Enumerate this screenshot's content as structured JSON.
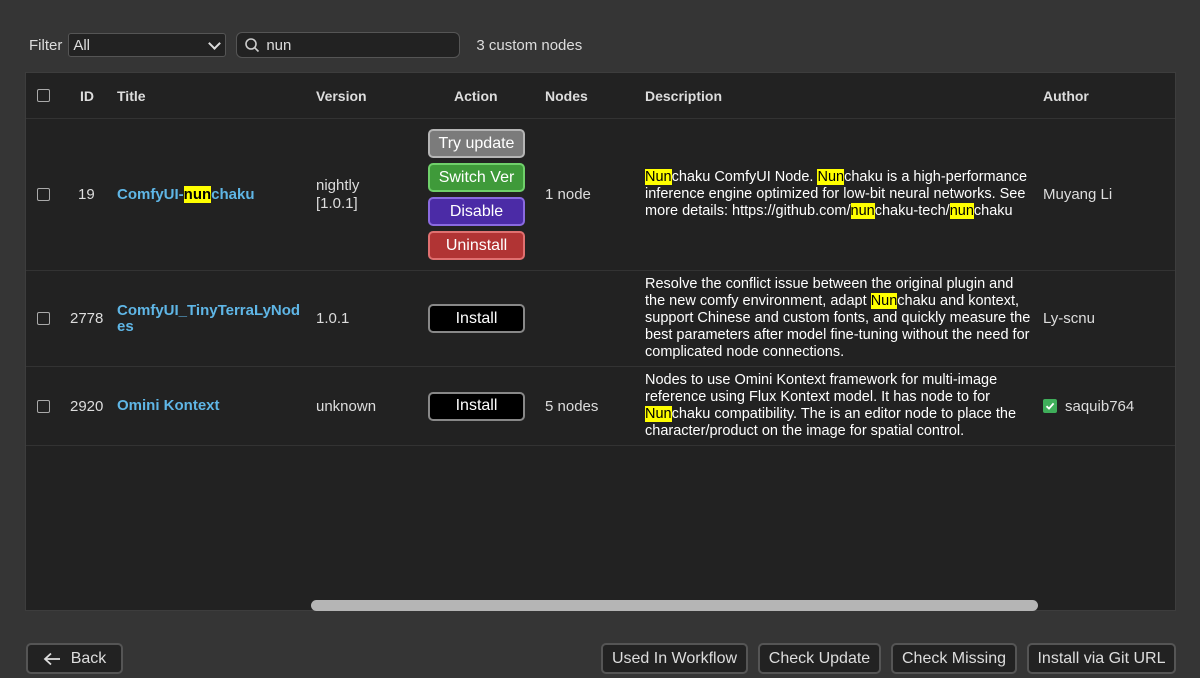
{
  "filter": {
    "label": "Filter",
    "selected": "All"
  },
  "search": {
    "value": "nun"
  },
  "count_text": "3 custom nodes",
  "columns": [
    "ID",
    "Title",
    "Version",
    "Action",
    "Nodes",
    "Description",
    "Author"
  ],
  "rows": [
    {
      "id": "19",
      "title_pre": "ComfyUI-",
      "title_hl": "nun",
      "title_post": "chaku",
      "version_line1": "nightly",
      "version_line2": "[1.0.1]",
      "actions": [
        "Try update",
        "Switch Ver",
        "Disable",
        "Uninstall"
      ],
      "nodes": "1 node",
      "desc": {
        "hl1": "Nun",
        "t1": "chaku ComfyUI Node. ",
        "hl2": "Nun",
        "t2": "chaku is a high-performance inference engine optimized for low-bit neural networks. See more details: https://github.com/",
        "hl3": "nun",
        "t3": "chaku-tech/",
        "hl4": "nun",
        "t4": "chaku"
      },
      "author": "Muyang Li"
    },
    {
      "id": "2778",
      "title": "ComfyUI_TinyTerraLyNodes",
      "version": "1.0.1",
      "actions": [
        "Install"
      ],
      "nodes": "",
      "desc": {
        "t1": "Resolve the conflict issue between the original plugin and the new comfy environment, adapt ",
        "hl1": "Nun",
        "t2": "chaku and kontext, support Chinese and custom fonts, and quickly measure the best parameters after model fine-tuning without the need for complicated node connections."
      },
      "author": "Ly-scnu"
    },
    {
      "id": "2920",
      "title": "Omini Kontext",
      "version": "unknown",
      "actions": [
        "Install"
      ],
      "nodes": "5 nodes",
      "desc": {
        "t1": "Nodes to use Omini Kontext framework for multi-image reference using Flux Kontext model. It has node to for ",
        "hl1": "Nun",
        "t2": "chaku compatibility. The is an editor node to place the character/product on the image for spatial control."
      },
      "author": "saquib764",
      "author_verified": true
    }
  ],
  "footer": {
    "back": "Back",
    "used_in_workflow": "Used In Workflow",
    "check_update": "Check Update",
    "check_missing": "Check Missing",
    "install_git": "Install via Git URL"
  },
  "colors": {
    "background": "#353535",
    "grid": "#222222",
    "link": "#5fb6e6",
    "highlight": "#ffff00",
    "try": "#7b7b7b",
    "switch": "#3f9a3a",
    "disable": "#4b2ba6",
    "uninstall": "#b13434",
    "install": "#000000"
  }
}
